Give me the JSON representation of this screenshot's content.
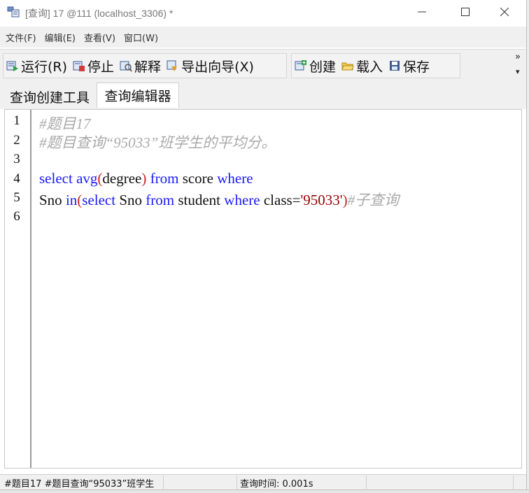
{
  "window": {
    "title": "[查询] 17 @111 (localhost_3306) *",
    "minimize": "—",
    "maximize": "☐",
    "close": "✕"
  },
  "menu": {
    "items": [
      {
        "label": "文件(F)"
      },
      {
        "label": "编辑(E)"
      },
      {
        "label": "查看(V)"
      },
      {
        "label": "窗口(W)"
      }
    ]
  },
  "toolbar": {
    "run": "运行(R)",
    "stop": "停止",
    "explain": "解释",
    "export_wizard": "导出向导(X)",
    "create": "创建",
    "load": "载入",
    "save": "保存",
    "more": "»",
    "more_arrow": "▾"
  },
  "tabs": [
    {
      "label": "查询创建工具"
    },
    {
      "label": "查询编辑器"
    }
  ],
  "editor": {
    "line_numbers": [
      "1",
      "2",
      "3",
      "4",
      "5",
      "6"
    ],
    "line1_comment": "#题目17",
    "line2_comment": "#题目查询“95033”班学生的平均分。",
    "line4": {
      "select": "select",
      "avg": "avg",
      "open": "(",
      "degree": "degree",
      "close": ")",
      "from": "from",
      "score": "score",
      "where": "where"
    },
    "line5": {
      "sno": "Sno",
      "in": "in",
      "open": "(",
      "select": "select",
      "sno2": "Sno",
      "from": "from",
      "student": "student",
      "where": "where",
      "class_eq": "class=",
      "value": "'95033'",
      "close": ")",
      "comment": "#子查询"
    }
  },
  "status": {
    "query_preview": "#题目17 #题目查询“95033”班学生",
    "query_time": "查询时间: 0.001s"
  }
}
